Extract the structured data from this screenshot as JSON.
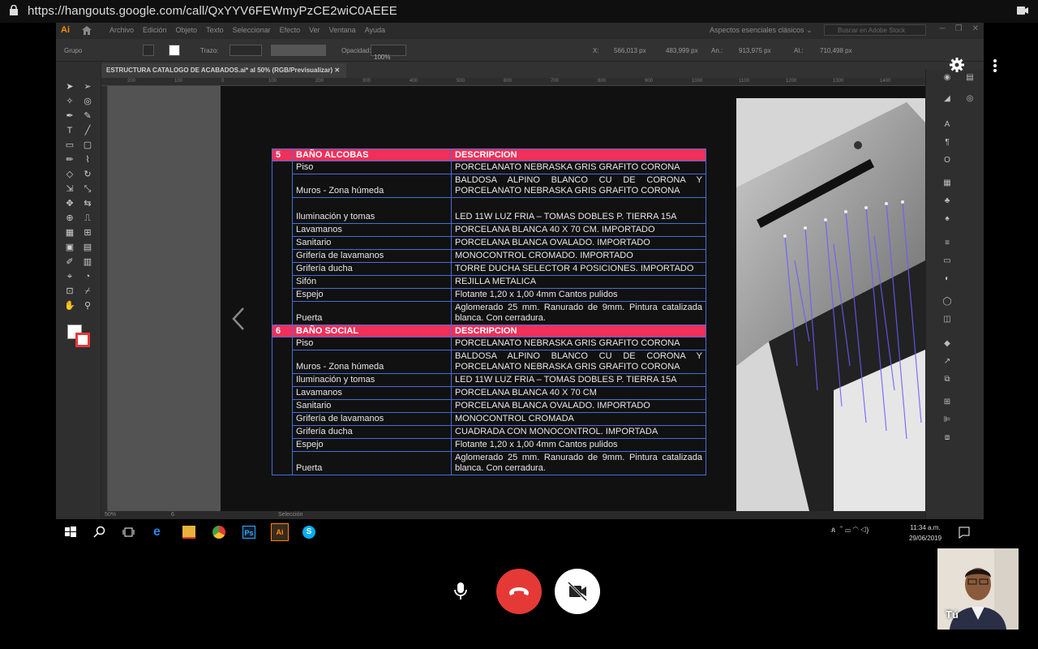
{
  "browser": {
    "url": "https://hangouts.google.com/call/QxYYV6FEWmyPzCE2wiC0AEEE"
  },
  "illustrator": {
    "logo": "Ai",
    "menus": [
      "Archivo",
      "Edición",
      "Objeto",
      "Texto",
      "Seleccionar",
      "Efecto",
      "Ver",
      "Ventana",
      "Ayuda"
    ],
    "workspace": "Aspectos esenciales clásicos",
    "stock_search_placeholder": "Buscar en Adobe Stock",
    "control": {
      "group_label": "Grupo",
      "stroke_label": "Trazo:",
      "opacity_label": "Opacidad:",
      "opacity_value": "100%",
      "x_label": "X:",
      "x_value": "566,013 px",
      "y_label": "Y:",
      "y_value": "483,999 px",
      "w_label": "An.:",
      "w_value": "913,975 px",
      "h_label": "Al.:",
      "h_value": "710,498 px"
    },
    "doc_tab": "ESTRUCTURA CATALOGO DE ACABADOS.ai* al 50% (RGB/Previsualizar)",
    "ruler_ticks": [
      "200",
      "100",
      "0",
      "100",
      "200",
      "300",
      "400",
      "500",
      "600",
      "700",
      "800",
      "900",
      "1000",
      "1100",
      "1200",
      "1300",
      "1400"
    ],
    "status": {
      "zoom": "50%",
      "artboard": "6",
      "tool": "Selección"
    }
  },
  "table": {
    "sections": [
      {
        "number": "5",
        "title": "BAÑO ALCOBAS",
        "desc_header": "DESCRIPCION",
        "rows": [
          {
            "item": "Piso",
            "desc": "PORCELANATO NEBRASKA GRIS GRAFITO CORONA",
            "justify": false
          },
          {
            "item": "Muros - Zona húmeda",
            "desc": "BALDOSA ALPINO BLANCO CU DE CORONA Y PORCELANATO NEBRASKA GRIS GRAFITO CORONA",
            "justify": true
          },
          {
            "item": "Iluminación y tomas",
            "desc": "LED 11W LUZ FRIA – TOMAS DOBLES P. TIERRA 15A",
            "justify": false
          },
          {
            "item": "Lavamanos",
            "desc": "PORCELANA BLANCA 40 X 70 CM. IMPORTADO",
            "justify": false
          },
          {
            "item": "Sanitario",
            "desc": "PORCELANA BLANCA OVALADO. IMPORTADO",
            "justify": false
          },
          {
            "item": "Grifería de lavamanos",
            "desc": "MONOCONTROL CROMADO. IMPORTADO",
            "justify": false
          },
          {
            "item": "Grifería ducha",
            "desc": "TORRE DUCHA SELECTOR 4 POSICIONES. IMPORTADO",
            "justify": false
          },
          {
            "item": "Sifón",
            "desc": "REJILLA METALICA",
            "justify": false
          },
          {
            "item": "Espejo",
            "desc": "Flotante 1,20 x 1,00 4mm Cantos pulidos",
            "justify": false
          },
          {
            "item": "Puerta",
            "desc": "Aglomerado 25 mm. Ranurado de 9mm. Pintura catalizada blanca. Con cerradura.",
            "justify": true
          }
        ]
      },
      {
        "number": "6",
        "title": "BAÑO SOCIAL",
        "desc_header": "DESCRIPCION",
        "rows": [
          {
            "item": "Piso",
            "desc": "PORCELANATO NEBRASKA GRIS GRAFITO CORONA",
            "justify": false
          },
          {
            "item": "Muros - Zona húmeda",
            "desc": "BALDOSA ALPINO BLANCO CU DE CORONA Y PORCELANATO NEBRASKA GRIS GRAFITO CORONA",
            "justify": true
          },
          {
            "item": "Iluminación y tomas",
            "desc": "LED 11W LUZ FRIA – TOMAS DOBLES P. TIERRA 15A",
            "justify": false
          },
          {
            "item": "Lavamanos",
            "desc": "PORCELANA BLANCA 40 X 70 CM",
            "justify": false
          },
          {
            "item": "Sanitario",
            "desc": "PORCELANA BLANCA OVALADO. IMPORTADO",
            "justify": false
          },
          {
            "item": "Grifería de lavamanos",
            "desc": "MONOCONTROL CROMADA",
            "justify": false
          },
          {
            "item": "Grifería ducha",
            "desc": "CUADRADA CON MONOCONTROL. IMPORTADA",
            "justify": false
          },
          {
            "item": "Espejo",
            "desc": "Flotante 1,20 x 1,00 4mm Cantos pulidos",
            "justify": false
          },
          {
            "item": "Puerta",
            "desc": "Aglomerado 25 mm. Ranurado de 9mm. Pintura catalizada blanca. Con cerradura.",
            "justify": true
          }
        ]
      }
    ]
  },
  "taskbar": {
    "time": "11:34 a.m.",
    "date": "29/06/2019"
  },
  "call": {
    "self_label": "Tú"
  },
  "colors": {
    "header_row": "#f0305a",
    "table_border": "#4a6cd4",
    "end_call": "#e53935"
  }
}
